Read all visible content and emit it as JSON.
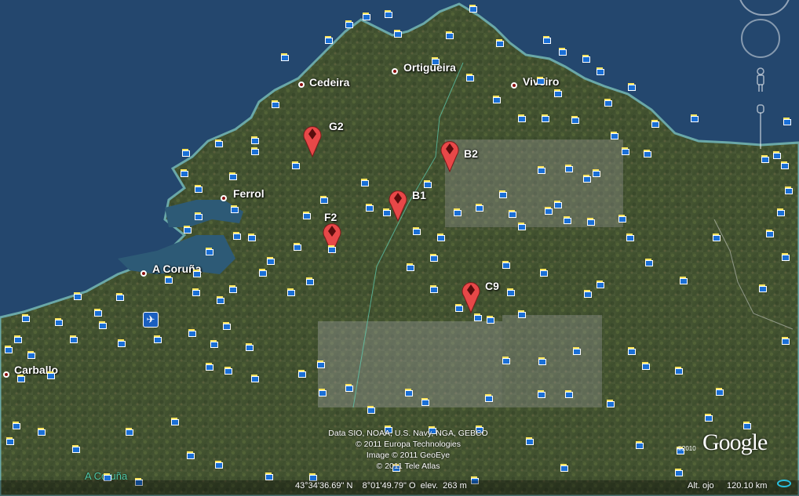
{
  "map": {
    "cities": [
      {
        "name": "Cedeira"
      },
      {
        "name": "Ortigueira"
      },
      {
        "name": "Viveiro"
      },
      {
        "name": "Ferrol"
      },
      {
        "name": "A Coruña"
      },
      {
        "name": "Carballo"
      }
    ],
    "markers": [
      {
        "label": "G2"
      },
      {
        "label": "B2"
      },
      {
        "label": "B1"
      },
      {
        "label": "F2"
      },
      {
        "label": "C9"
      }
    ],
    "province_label": "A Coruña",
    "marker_color": "#e84848",
    "water_color": "#24476e"
  },
  "attribution": {
    "line1": "Data SIO, NOAA, U.S. Navy, NGA, GEBCO",
    "line2": "© 2011 Europa Technologies",
    "line3": "Image © 2011 GeoEye",
    "line4": "© 2011 Tele Atlas"
  },
  "status": {
    "coordinates": "43°34'36.69\" N    8°01'49.79\" O  elev.  263 m",
    "altitude_label": "Alt. ojo",
    "altitude_value": "120.10 km"
  },
  "logo": {
    "text": "Google",
    "copyright": "©2010"
  },
  "icons": [
    "compass-icon",
    "look-icon",
    "pegman-icon",
    "zoom-slider-icon",
    "airport-icon",
    "placemark-icon"
  ]
}
